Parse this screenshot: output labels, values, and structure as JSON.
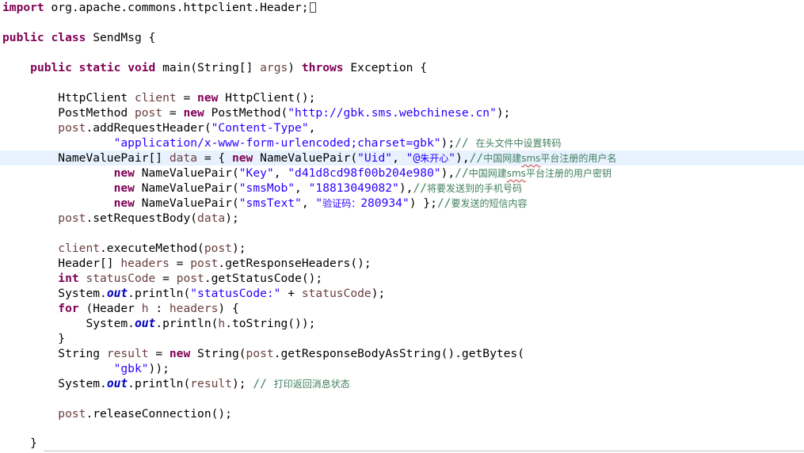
{
  "k": {
    "import": "import",
    "public": "public",
    "class": "class",
    "static": "static",
    "void": "void",
    "throws": "throws",
    "new": "new",
    "int": "int",
    "for": "for"
  },
  "l1": {
    "pkg": " org.apache.commons.httpclient.Header;"
  },
  "l2": {
    "name": " SendMsg {"
  },
  "l3": {
    "sig1": " main(String[] ",
    "args": "args",
    "sig2": ") ",
    "sig3": " Exception {"
  },
  "l4": {
    "t": "HttpClient ",
    "v": "client",
    "eq": " = ",
    "call": " HttpClient();"
  },
  "l5": {
    "t": "PostMethod ",
    "v": "post",
    "eq": " = ",
    "call": " PostMethod(",
    "url": "\"http://gbk.sms.webchinese.cn\"",
    "end": ");"
  },
  "l6": {
    "v": "post",
    "m": ".addRequestHeader(",
    "s": "\"Content-Type\"",
    "end": ","
  },
  "l7": {
    "s": "\"application/x-www-form-urlencoded;charset=gbk\"",
    "end": ");",
    "c": "// ",
    "cn": "在头文件中设置转码"
  },
  "l8": {
    "t": "NameValuePair[] ",
    "v": "data",
    "mid": " = { ",
    "call": " NameValuePair(",
    "s1": "\"Uid\"",
    "sep": ", ",
    "s2a": "\"@",
    "s2cn": "朱开心",
    "s2b": "\"",
    "end": "),",
    "c": "//",
    "cn1": "中国网建",
    "sms": "sms",
    "cn2": "平台注册的用户名"
  },
  "l9": {
    "call": " NameValuePair(",
    "s1": "\"Key\"",
    "sep": ", ",
    "s2": "\"d41d8cd98f00b204e980\"",
    "end": "),",
    "c": "//",
    "cn1": "中国网建",
    "sms": "sms",
    "cn2": "平台注册的用户密钥"
  },
  "l10": {
    "call": " NameValuePair(",
    "s1": "\"smsMob\"",
    "sep": ", ",
    "s2": "\"18813049082\"",
    "end": "),",
    "c": "//",
    "cn": "将要发送到的手机号码"
  },
  "l11": {
    "call": " NameValuePair(",
    "s1": "\"smsText\"",
    "sep": ", ",
    "s2a": "\"",
    "s2cn": "验证码：",
    "s2b": "280934\"",
    "end": ") };",
    "c": "//",
    "cn": "要发送的短信内容"
  },
  "l12": {
    "v": "post",
    "m": ".setRequestBody(",
    "v2": "data",
    "end": ");"
  },
  "l13": {
    "v": "client",
    "m": ".executeMethod(",
    "v2": "post",
    "end": ");"
  },
  "l14": {
    "t": "Header[] ",
    "v": "headers",
    "eq": " = ",
    "v2": "post",
    "m": ".getResponseHeaders();"
  },
  "l15": {
    "v": "statusCode",
    "eq": " = ",
    "v2": "post",
    "m": ".getStatusCode();"
  },
  "l16": {
    "a": "System.",
    "f": "out",
    "b": ".println(",
    "s": "\"statusCode:\"",
    "plus": " + ",
    "v": "statusCode",
    "end": ");"
  },
  "l17": {
    "a": " (Header ",
    "v": "h",
    "b": " : ",
    "v2": "headers",
    "end": ") {"
  },
  "l18": {
    "a": "System.",
    "f": "out",
    "b": ".println(",
    "v": "h",
    "end": ".toString());"
  },
  "l19": {
    "t": "}"
  },
  "l20": {
    "t": "String ",
    "v": "result",
    "eq": " = ",
    "a": " String(",
    "v2": "post",
    "m": ".getResponseBodyAsString().getBytes("
  },
  "l21": {
    "s": "\"gbk\"",
    "end": "));"
  },
  "l22": {
    "a": "System.",
    "f": "out",
    "b": ".println(",
    "v": "result",
    "end": "); ",
    "c": "// ",
    "cn": "打印返回消息状态"
  },
  "l23": {
    "v": "post",
    "m": ".releaseConnection();"
  },
  "l24": {
    "t": "}"
  }
}
